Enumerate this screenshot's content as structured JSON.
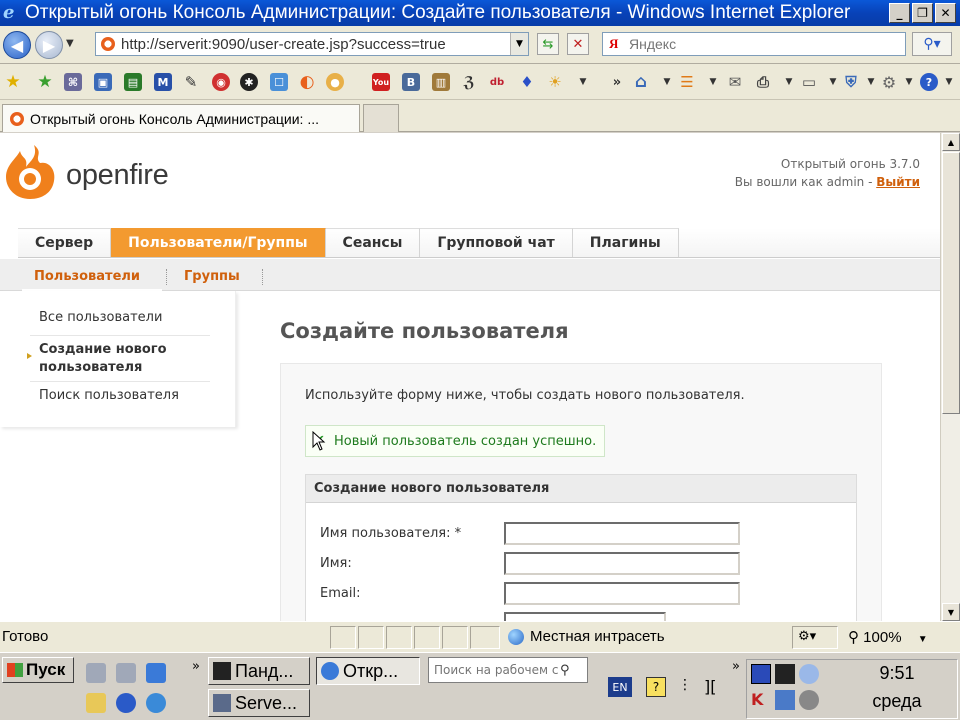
{
  "window": {
    "title": "Открытый огонь Консоль Администрации: Создайте пользователя - Windows Internet Explorer"
  },
  "addressbar": {
    "url": "http://serverit:9090/user-create.jsp?success=true",
    "search_placeholder": "Яндекс"
  },
  "tab": {
    "label": "Открытый огонь Консоль Администрации: ..."
  },
  "header": {
    "logo_text": "openfire",
    "version": "Открытый огонь 3.7.0",
    "logged_in_prefix": "Вы вошли как admin - ",
    "logout": "Выйти"
  },
  "topnav": [
    "Сервер",
    "Пользователи/Группы",
    "Сеансы",
    "Групповой чат",
    "Плагины"
  ],
  "subnav": [
    "Пользователи",
    "Группы"
  ],
  "sidebar": [
    {
      "label": "Все пользователи"
    },
    {
      "label": "Создание нового пользователя"
    },
    {
      "label": "Поиск пользователя"
    }
  ],
  "main": {
    "title": "Создайте пользователя",
    "intro": "Используйте форму ниже, чтобы создать нового пользователя.",
    "success": "Новый пользователь создан успешно.",
    "panel_title": "Создание нового пользователя",
    "fields": [
      {
        "label": "Имя пользователя: *",
        "value": ""
      },
      {
        "label": "Имя:",
        "value": ""
      },
      {
        "label": "Email:",
        "value": ""
      }
    ]
  },
  "statusbar": {
    "status": "Готово",
    "zone": "Местная интрасеть",
    "zoom": "100%"
  },
  "taskbar": {
    "start": "Пуск",
    "tasks": [
      "Панд...",
      "Откр...",
      "Serve..."
    ],
    "search_placeholder": "Поиск на рабочем с",
    "lang": "EN",
    "time": "9:51",
    "day": "среда"
  },
  "colors": {
    "ie_titlebar": "#0842b8",
    "openfire_orange": "#f39a30",
    "link_orange": "#d0600c",
    "success_green": "#1d7a1d"
  }
}
